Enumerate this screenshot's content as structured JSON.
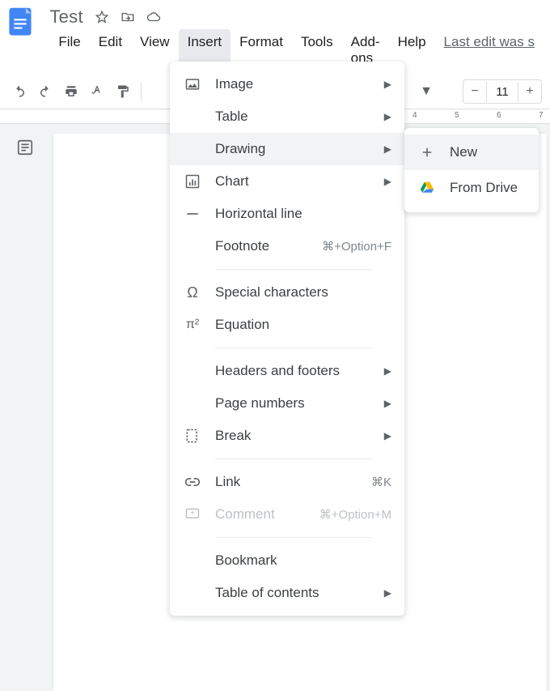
{
  "document": {
    "title": "Test",
    "last_edit": "Last edit was s"
  },
  "menubar": {
    "file": "File",
    "edit": "Edit",
    "view": "View",
    "insert": "Insert",
    "format": "Format",
    "tools": "Tools",
    "addons": "Add-ons",
    "help": "Help"
  },
  "toolbar": {
    "font_size": "11"
  },
  "ruler": {
    "marks": [
      "4",
      "5",
      "6",
      "7"
    ]
  },
  "insert_menu": {
    "image": "Image",
    "table": "Table",
    "drawing": "Drawing",
    "chart": "Chart",
    "horizontal_line": "Horizontal line",
    "footnote": "Footnote",
    "footnote_shortcut": "⌘+Option+F",
    "special_characters": "Special characters",
    "equation": "Equation",
    "headers_footers": "Headers and footers",
    "page_numbers": "Page numbers",
    "break": "Break",
    "link": "Link",
    "link_shortcut": "⌘K",
    "comment": "Comment",
    "comment_shortcut": "⌘+Option+M",
    "bookmark": "Bookmark",
    "table_of_contents": "Table of contents"
  },
  "drawing_submenu": {
    "new": "New",
    "from_drive": "From Drive"
  }
}
